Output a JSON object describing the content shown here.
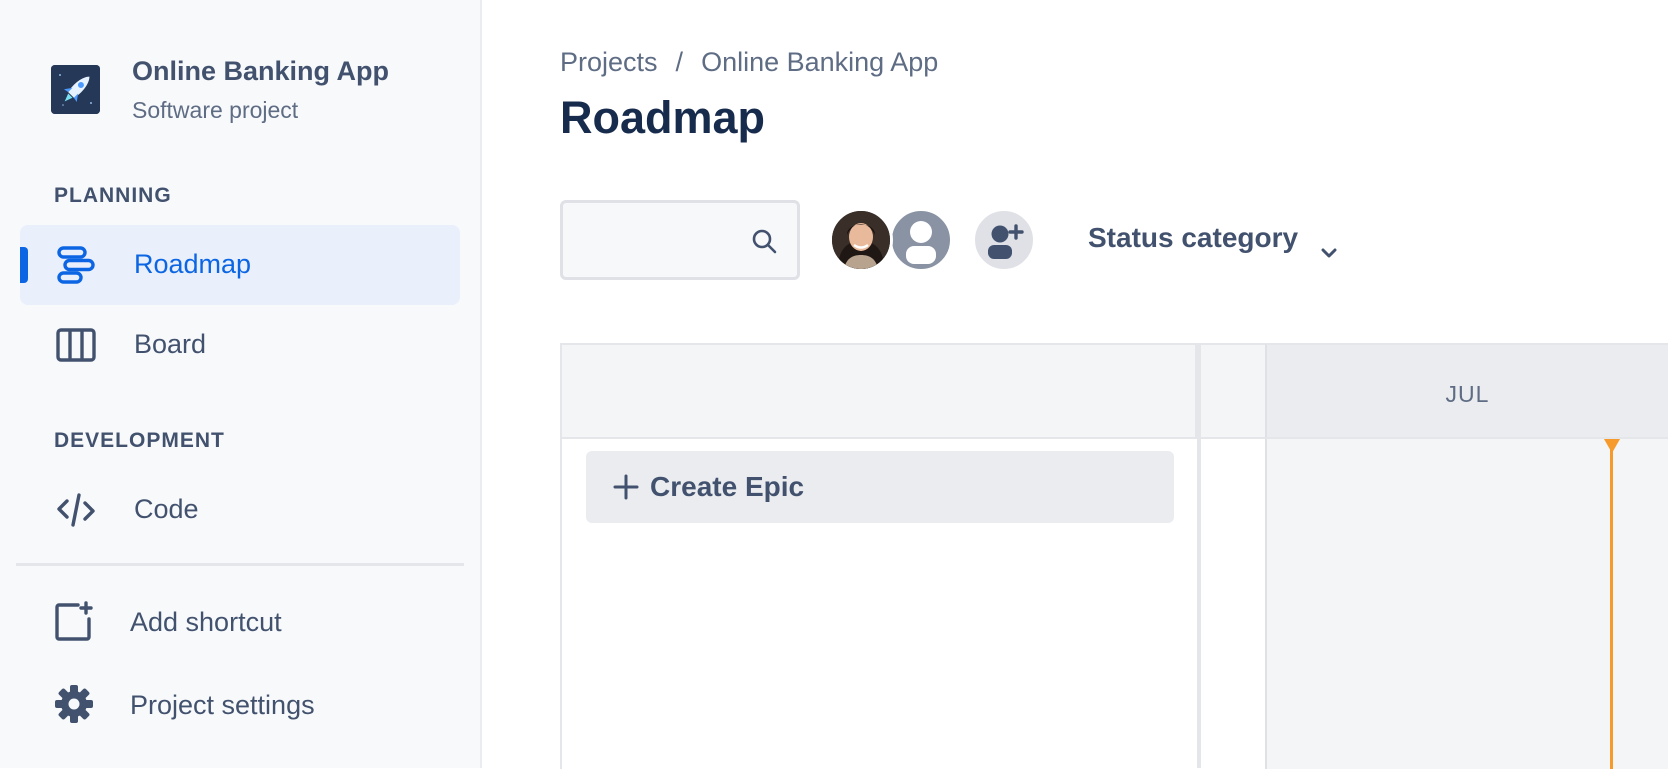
{
  "project": {
    "name": "Online Banking App",
    "type": "Software project"
  },
  "sidebar": {
    "sections": [
      {
        "heading": "PLANNING",
        "items": [
          {
            "label": "Roadmap",
            "icon": "roadmap-icon",
            "active": true
          },
          {
            "label": "Board",
            "icon": "board-icon",
            "active": false
          }
        ]
      },
      {
        "heading": "DEVELOPMENT",
        "items": [
          {
            "label": "Code",
            "icon": "code-icon",
            "active": false
          }
        ]
      }
    ],
    "bottom": [
      {
        "label": "Add shortcut",
        "icon": "add-shortcut-icon"
      },
      {
        "label": "Project settings",
        "icon": "gear-icon"
      }
    ]
  },
  "breadcrumb": {
    "items": [
      "Projects",
      "Online Banking App"
    ],
    "separator": "/"
  },
  "page": {
    "title": "Roadmap"
  },
  "toolbar": {
    "search": {
      "value": "",
      "placeholder": ""
    },
    "avatars": [
      "user-photo-avatar",
      "generic-user-avatar"
    ],
    "add_people_icon": "add-people-icon",
    "status_filter_label": "Status category"
  },
  "roadmap": {
    "month_label": "JUL",
    "create_epic_label": "Create Epic"
  },
  "colors": {
    "accent": "#0C66E4",
    "today_marker": "#F79A2C",
    "sidebar_bg": "#F8F9FB",
    "text_primary": "#172B4D",
    "text_secondary": "#42526E"
  }
}
